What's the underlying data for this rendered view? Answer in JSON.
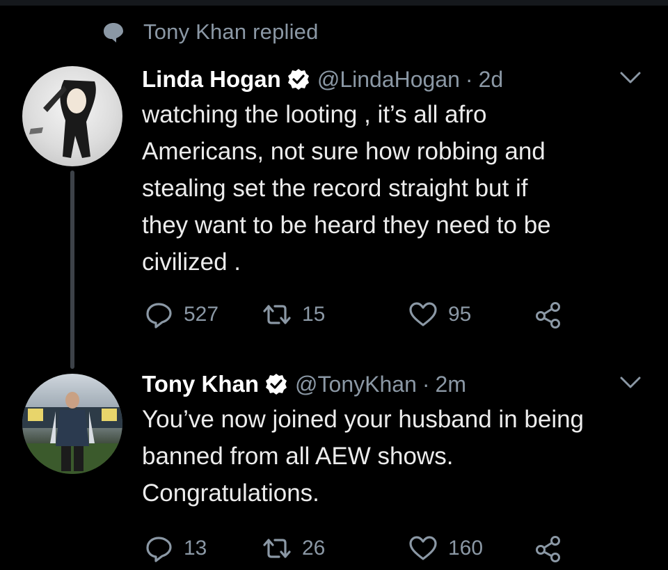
{
  "context": {
    "text": "Tony Khan replied"
  },
  "tweets": [
    {
      "author_name": "Linda Hogan",
      "handle": "@LindaHogan",
      "separator": "·",
      "time": "2d",
      "lines": [
        "watching the looting , it’s all afro",
        "Americans, not sure how robbing and",
        "stealing set the record straight but if",
        "they want to be heard they need to be",
        "civilized ."
      ],
      "replies": "527",
      "retweets": "15",
      "likes": "95"
    },
    {
      "author_name": "Tony Khan",
      "handle": "@TonyKhan",
      "separator": "·",
      "time": "2m",
      "lines": [
        "You’ve now joined your husband in being",
        "banned from all AEW shows.",
        "Congratulations."
      ],
      "replies": "13",
      "retweets": "26",
      "likes": "160"
    }
  ],
  "colors": {
    "background": "#000000",
    "primary_text": "#ffffff",
    "secondary_text": "#8b98a5",
    "thread_line": "#3d4248"
  },
  "icons": [
    "reply-context-icon",
    "verified-icon",
    "caret-down-icon",
    "reply-icon",
    "retweet-icon",
    "like-icon",
    "share-icon"
  ]
}
